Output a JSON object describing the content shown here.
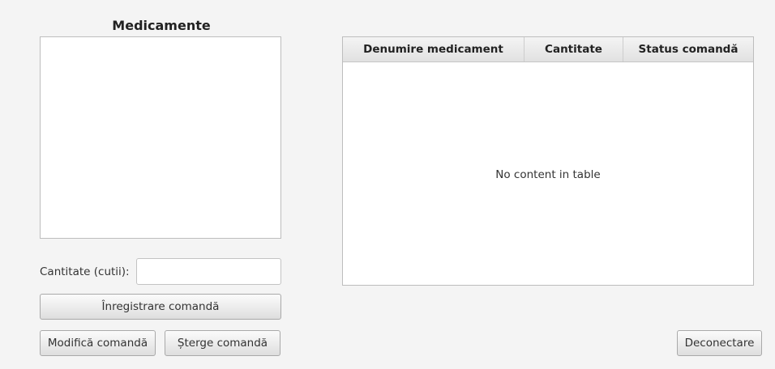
{
  "medicines_panel": {
    "title": "Medicamente"
  },
  "form": {
    "quantity_label": "Cantitate (cutii):",
    "quantity_value": "",
    "register_button": "Înregistrare comandă",
    "modify_button": "Modifică comandă",
    "delete_button": "Șterge comandă"
  },
  "orders_table": {
    "columns": [
      "Denumire medicament",
      "Cantitate",
      "Status comandă"
    ],
    "empty_text": "No content in table"
  },
  "logout_button": "Deconectare"
}
